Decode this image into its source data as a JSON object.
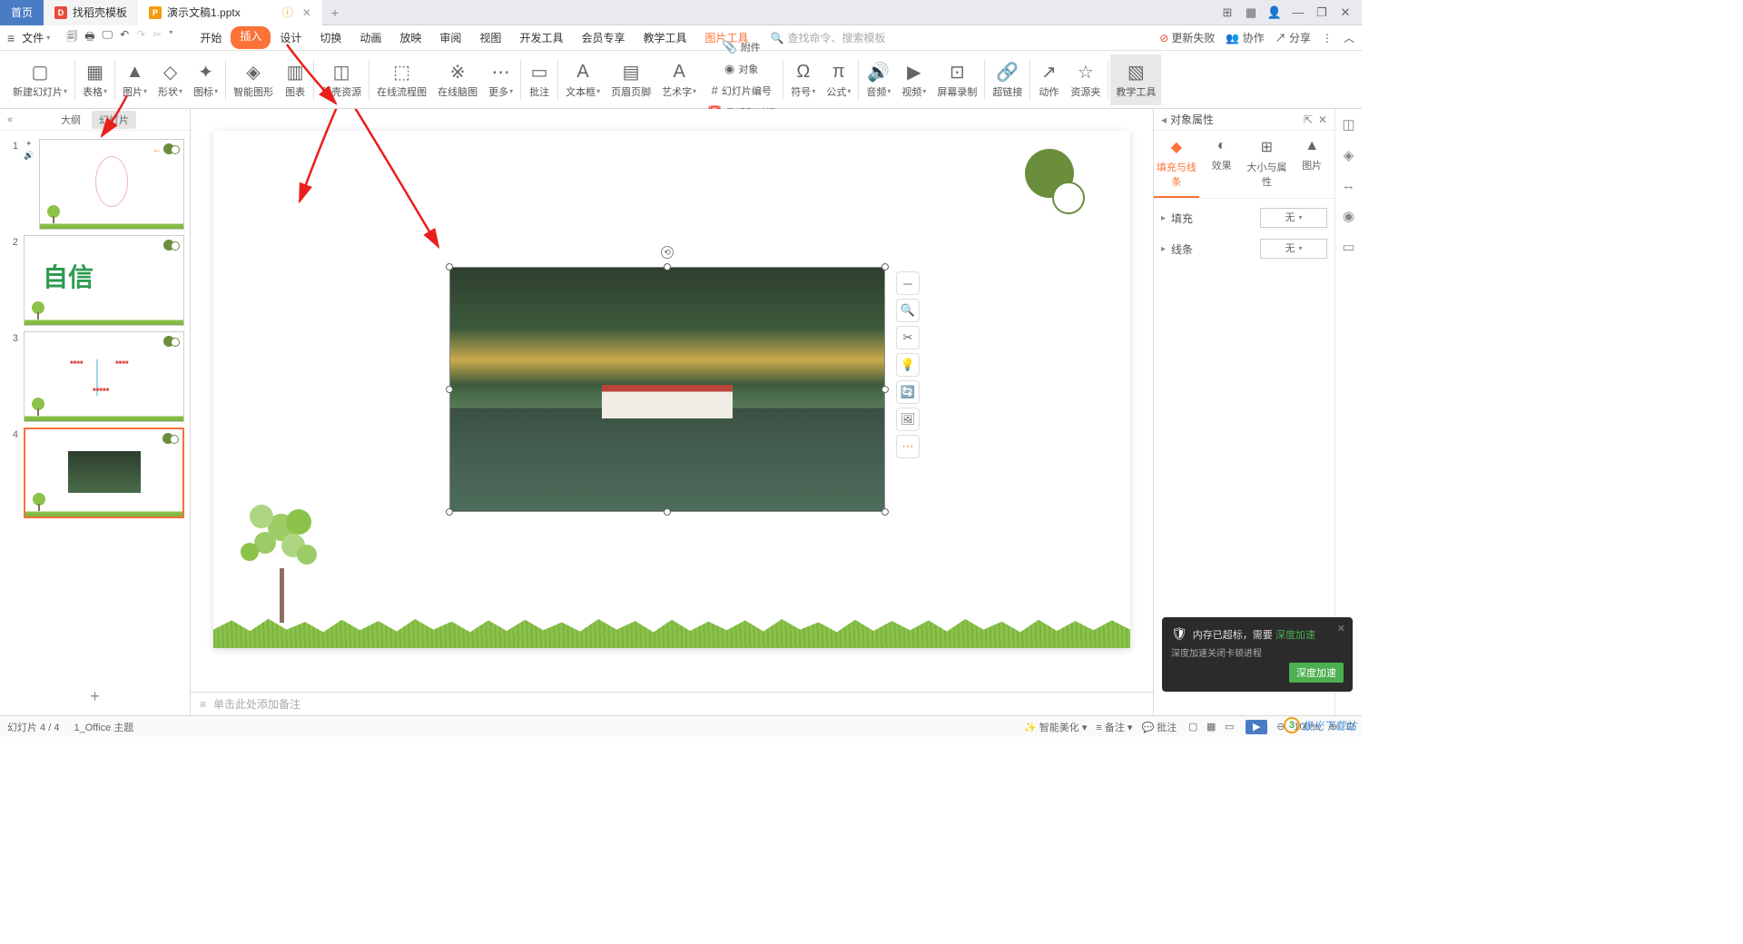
{
  "titleBar": {
    "tabs": [
      {
        "label": "首页",
        "type": "home"
      },
      {
        "label": "找稻壳模板",
        "type": "doc"
      },
      {
        "label": "演示文稿1.pptx",
        "type": "active"
      }
    ],
    "addTab": "+"
  },
  "windowControls": {
    "layout": "⊞",
    "grid": "▦",
    "user": "👤",
    "min": "—",
    "max": "❐",
    "close": "✕"
  },
  "menuBar": {
    "fileMenu": "文件",
    "tabs": [
      "开始",
      "插入",
      "设计",
      "切换",
      "动画",
      "放映",
      "审阅",
      "视图",
      "开发工具",
      "会员专享",
      "教学工具"
    ],
    "contextTab": "图片工具",
    "activeTab": "插入",
    "searchPlaceholder": "查找命令、搜索模板",
    "updateFail": "更新失败",
    "collab": "协作",
    "share": "分享"
  },
  "ribbon": [
    {
      "label": "新建幻灯片",
      "icon": "▢",
      "caret": true
    },
    {
      "sep": true
    },
    {
      "label": "表格",
      "icon": "▦",
      "caret": true
    },
    {
      "sep": true
    },
    {
      "label": "图片",
      "icon": "▲",
      "caret": true
    },
    {
      "label": "形状",
      "icon": "◇",
      "caret": true
    },
    {
      "label": "图标",
      "icon": "✦",
      "caret": true
    },
    {
      "sep": true
    },
    {
      "label": "智能图形",
      "icon": "◈"
    },
    {
      "label": "图表",
      "icon": "▥"
    },
    {
      "sep": true
    },
    {
      "label": "稻壳资源",
      "icon": "◫"
    },
    {
      "sep": true
    },
    {
      "label": "在线流程图",
      "icon": "⬚"
    },
    {
      "label": "在线脑图",
      "icon": "※"
    },
    {
      "label": "更多",
      "icon": "⋯",
      "caret": true
    },
    {
      "sep": true
    },
    {
      "label": "批注",
      "icon": "▭"
    },
    {
      "sep": true
    },
    {
      "label": "文本框",
      "icon": "A",
      "caret": true
    },
    {
      "label": "页眉页脚",
      "icon": "▤"
    },
    {
      "label": "艺术字",
      "icon": "A",
      "caret": true
    },
    {
      "label": "附件",
      "icon": "📎",
      "inline": true
    },
    {
      "label": "对象",
      "icon": "◉",
      "inline": true
    },
    {
      "label": "幻灯片编号",
      "icon": "#",
      "inline": true
    },
    {
      "label": "日期和时间",
      "icon": "📅",
      "inline": true
    },
    {
      "sep": true
    },
    {
      "label": "符号",
      "icon": "Ω",
      "caret": true
    },
    {
      "label": "公式",
      "icon": "π",
      "caret": true
    },
    {
      "sep": true
    },
    {
      "label": "音频",
      "icon": "🔊",
      "caret": true
    },
    {
      "label": "视频",
      "icon": "▶",
      "caret": true
    },
    {
      "label": "屏幕录制",
      "icon": "⊡"
    },
    {
      "sep": true
    },
    {
      "label": "超链接",
      "icon": "🔗"
    },
    {
      "sep": true
    },
    {
      "label": "动作",
      "icon": "↗"
    },
    {
      "label": "资源夹",
      "icon": "☆"
    },
    {
      "sep": true
    },
    {
      "label": "教学工具",
      "icon": "▧",
      "highlight": true
    }
  ],
  "slidePanel": {
    "tabs": [
      "大纲",
      "幻灯片"
    ],
    "activeTab": "幻灯片",
    "slides": [
      {
        "num": "1"
      },
      {
        "num": "2",
        "text": "自信"
      },
      {
        "num": "3"
      },
      {
        "num": "4"
      }
    ],
    "activeSlide": 4
  },
  "notesPlaceholder": "单击此处添加备注",
  "propPanel": {
    "title": "对象属性",
    "tabs": [
      "填充与线条",
      "效果",
      "大小与属性",
      "图片"
    ],
    "activeTab": "填充与线条",
    "rows": [
      {
        "label": "填充",
        "value": "无"
      },
      {
        "label": "线条",
        "value": "无"
      }
    ]
  },
  "statusBar": {
    "left": "幻灯片 4 / 4",
    "theme": "1_Office 主题",
    "beautify": "智能美化",
    "notes": "备注",
    "comments": "批注",
    "zoom": "100%"
  },
  "toast": {
    "title": "内存已超标，需要",
    "highlight": "深度加速",
    "sub": "深度加速关闭卡顿进程",
    "btn": "深度加速"
  },
  "watermark": "极光下载站",
  "imgTools": [
    "－",
    "⊕",
    "�extent",
    "💡",
    "↔",
    "🖼",
    "⋯"
  ]
}
